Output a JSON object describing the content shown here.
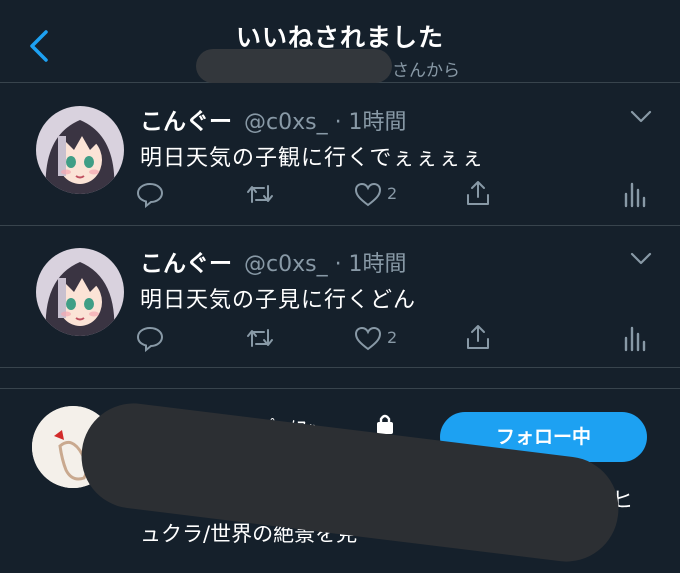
{
  "header": {
    "title": "いいねされました",
    "subtitle_suffix": "さんから"
  },
  "tweets": [
    {
      "display_name": "こんぐー",
      "handle_time": "@c0xs_ · 1時間",
      "text": "明日天気の子観に行くでぇぇぇぇ",
      "like_count": "2"
    },
    {
      "display_name": "こんぐー",
      "handle_time": "@c0xs_ · 1時間",
      "text": "明日天気の子見に行くどん",
      "like_count": "2"
    }
  ],
  "user_card": {
    "follow_label": "フォロー中",
    "bio_line_end": "ヒ",
    "bio_line_2": "ュクラ/世界の絶景を見",
    "name_fragment": "ﾟ ﾒﾌｯ"
  },
  "colors": {
    "background": "#15202b",
    "divider": "#38444d",
    "secondary_text": "#8899a6",
    "accent": "#1da1f2"
  },
  "icons": [
    "back-arrow-icon",
    "chevron-down-icon",
    "reply-icon",
    "retweet-icon",
    "like-icon",
    "share-icon",
    "analytics-icon",
    "lock-icon"
  ]
}
